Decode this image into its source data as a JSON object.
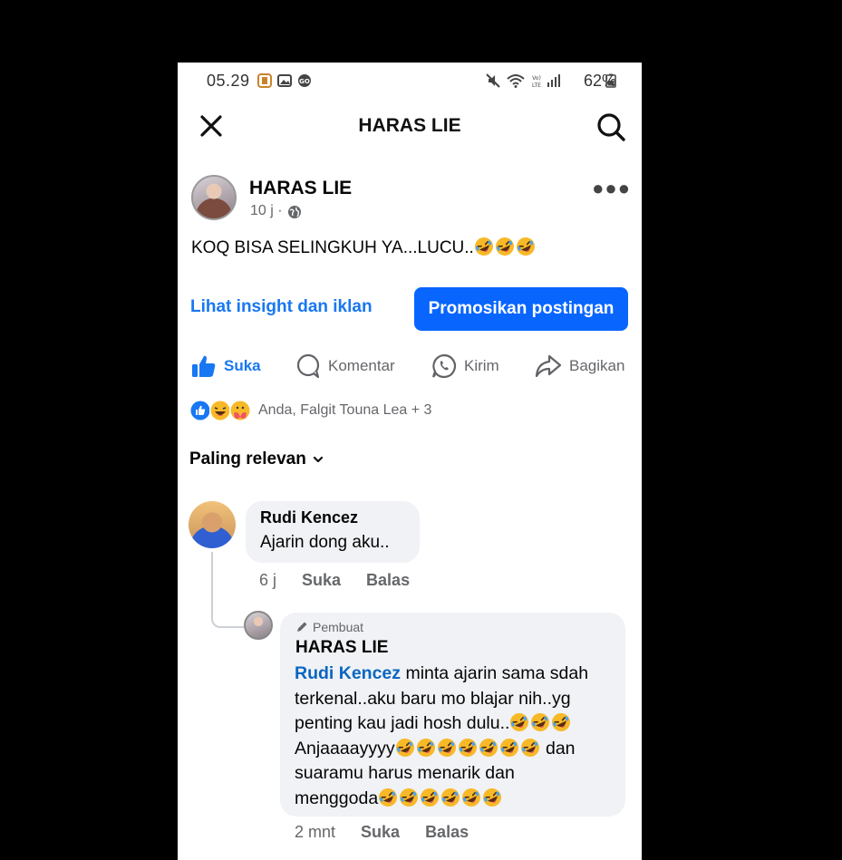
{
  "status_bar": {
    "time": "05.29",
    "battery": "62%",
    "left_icons": [
      "app-notification-icon",
      "gallery-icon",
      "go-icon"
    ],
    "right_icons": [
      "mute-icon",
      "wifi-icon",
      "volte-icon",
      "signal-icon",
      "battery-icon"
    ]
  },
  "header": {
    "title": "HARAS LIE",
    "left_icon": "close-icon",
    "right_icon": "search-icon"
  },
  "post": {
    "author": "HARAS LIE",
    "time": "10 j ·",
    "visibility_icon": "globe-icon",
    "text": "KOQ BISA SELINGKUH YA...LUCU..",
    "text_emoji_count": 3,
    "insight_link": "Lihat insight dan iklan",
    "promote_button": "Promosikan postingan"
  },
  "actions": {
    "like": "Suka",
    "comment": "Komentar",
    "send": "Kirim",
    "share": "Bagikan"
  },
  "reactions": {
    "text": "Anda, Falgit Touna Lea + 3",
    "icons": [
      "like-reaction-icon",
      "haha-reaction-icon",
      "care-reaction-icon"
    ]
  },
  "sort": {
    "label": "Paling relevan"
  },
  "comments": [
    {
      "author": "Rudi Kencez",
      "text": "Ajarin dong aku..",
      "time": "6 j",
      "like": "Suka",
      "reply": "Balas"
    }
  ],
  "reply": {
    "badge": "Pembuat",
    "author": "HARAS LIE",
    "mention": "Rudi Kencez",
    "line1": " minta ajarin sama sdah terkenal..aku baru mo blajar nih..yg penting kau jadi hosh dulu..",
    "line2": "Anjaaaayyyy",
    "line3": " dan suaramu harus menarik dan menggoda",
    "time": "2 mnt",
    "like": "Suka",
    "reply": "Balas"
  },
  "colors": {
    "accent": "#1877f2",
    "button": "#0866ff",
    "bubble": "#f0f2f5",
    "muted": "#65676b"
  }
}
